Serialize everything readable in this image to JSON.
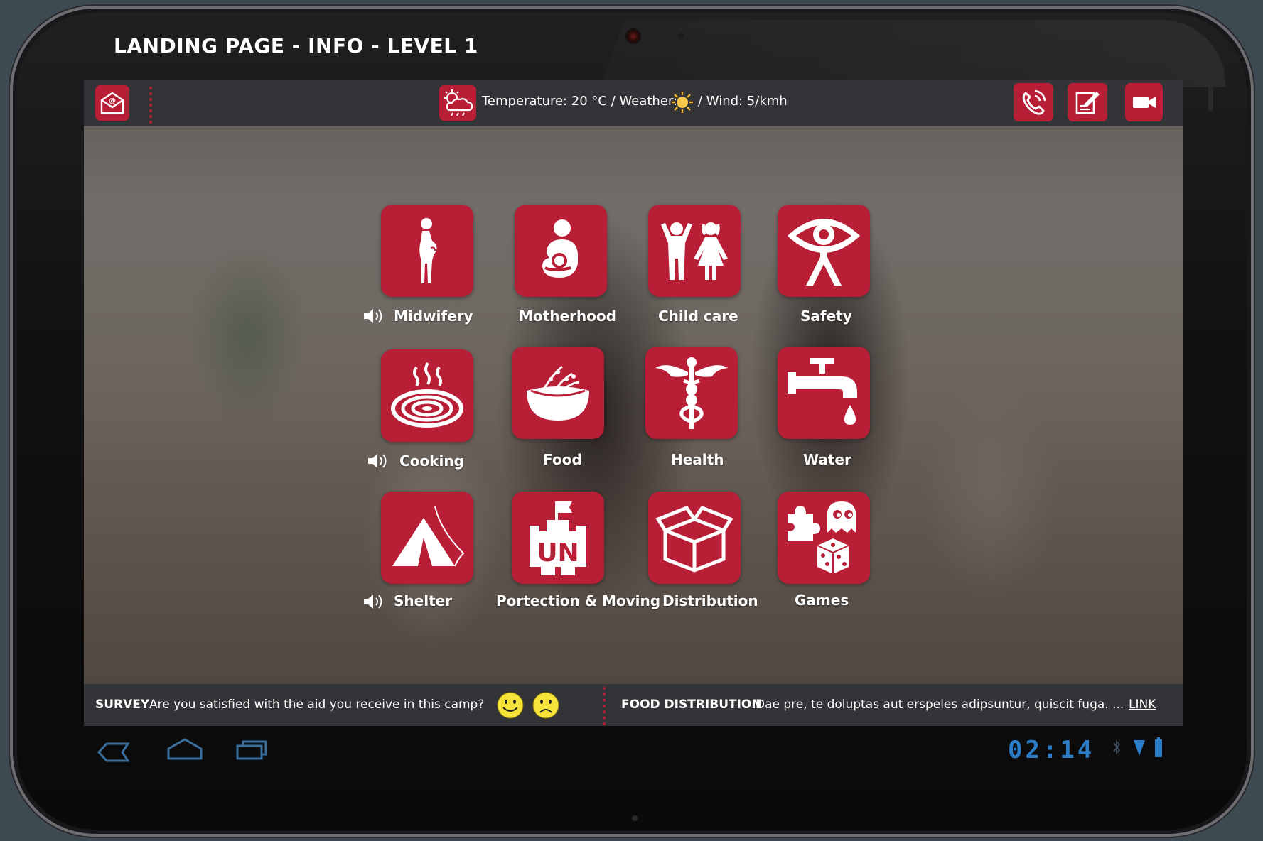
{
  "page_title": "LANDING PAGE - INFO - LEVEL 1",
  "colors": {
    "accent_red": "#b81e35",
    "bar_dark": "#333437",
    "status_blue": "#2a7dc9"
  },
  "topbar": {
    "mail_icon": "mail-icon",
    "weather_icon": "weather-icon",
    "temperature_text": "Temperature: 20 °C / Weather:",
    "weather_condition_icon": "sun-icon",
    "wind_text": "/ Wind: 5/kmh",
    "actions": [
      "phone-icon",
      "notes-icon",
      "video-camera-icon"
    ]
  },
  "tiles": [
    {
      "label": "Midwifery",
      "icon": "pregnant-woman-icon",
      "audio": true
    },
    {
      "label": "Motherhood",
      "icon": "mother-baby-icon",
      "audio": false
    },
    {
      "label": "Child care",
      "icon": "children-icon",
      "audio": false
    },
    {
      "label": "Safety",
      "icon": "eye-person-icon",
      "audio": false
    },
    {
      "label": "Cooking",
      "icon": "stove-icon",
      "audio": true
    },
    {
      "label": "Food",
      "icon": "food-bowl-icon",
      "audio": false
    },
    {
      "label": "Health",
      "icon": "caduceus-icon",
      "audio": false
    },
    {
      "label": "Water",
      "icon": "water-tap-icon",
      "audio": false
    },
    {
      "label": "Shelter",
      "icon": "tent-icon",
      "audio": true
    },
    {
      "label": "Portection & Moving",
      "icon": "un-building-icon",
      "audio": false
    },
    {
      "label": "Distribution",
      "icon": "box-icon",
      "audio": false
    },
    {
      "label": "Games",
      "icon": "games-icon",
      "audio": false
    }
  ],
  "bottombar": {
    "survey_label": "SURVEY",
    "survey_question": "Are you satisfied with the aid you receive in this camp?",
    "survey_options": [
      "happy-face-icon",
      "sad-face-icon"
    ],
    "news_label": "FOOD DISTRIBUTION",
    "news_text": "Dae pre, te doluptas aut erspeles adipsuntur, quiscit fuga. ...",
    "news_link": "LINK"
  },
  "system": {
    "nav": [
      "back-icon",
      "home-icon",
      "recent-apps-icon"
    ],
    "clock": "02:14",
    "status_icons": [
      "bluetooth-icon",
      "signal-icon",
      "battery-icon"
    ]
  }
}
